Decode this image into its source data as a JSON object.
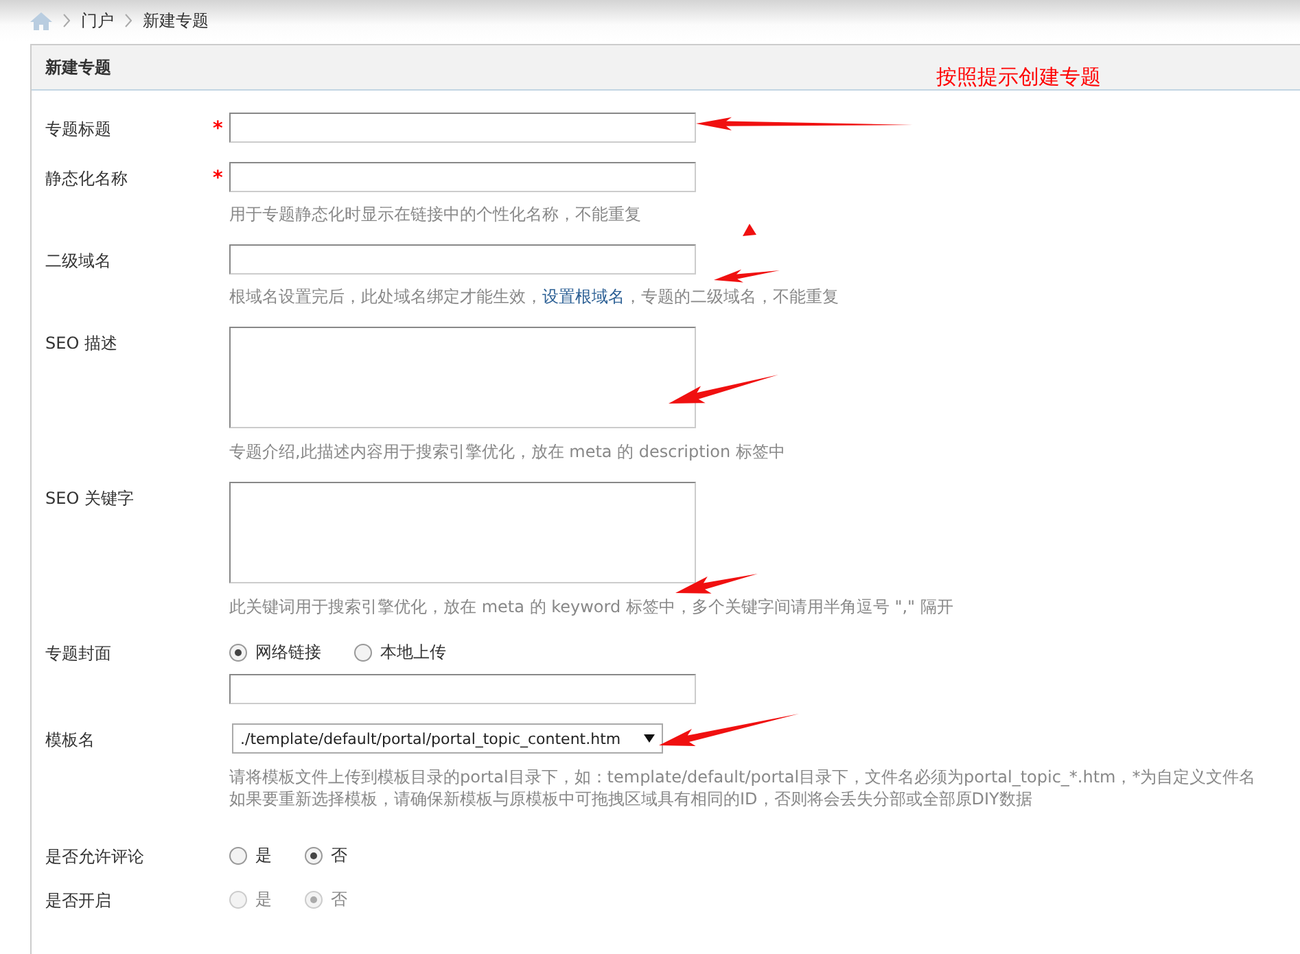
{
  "breadcrumb": [
    "门户",
    "新建专题"
  ],
  "panel": {
    "title": "新建专题",
    "annotation": "按照提示创建专题"
  },
  "fields": [
    {
      "kind": "text",
      "label": "专题标题",
      "required_mark": "*"
    },
    {
      "kind": "text",
      "label": "静态化名称",
      "required_mark": "*",
      "hint": [
        "用于专题静态化时显示在链接中的个性化名称，不能重复"
      ]
    },
    {
      "kind": "text",
      "label": "二级域名",
      "hint_before": "根域名设置完后，此处域名绑定才能生效，",
      "hint_link": "设置根域名",
      "hint_after": "，专题的二级域名，不能重复"
    },
    {
      "kind": "textarea",
      "label": "SEO 描述",
      "hint": [
        "专题介绍,此描述内容用于搜索引擎优化，放在 meta 的 description 标签中"
      ]
    },
    {
      "kind": "textarea",
      "label": "SEO 关键字",
      "hint": [
        "此关键词用于搜索引擎优化，放在 meta 的 keyword 标签中，多个关键字间请用半角逗号 \",\" 隔开"
      ]
    },
    {
      "kind": "radio_input",
      "label": "专题封面",
      "disabled": false,
      "options": [
        {
          "label": "网络链接",
          "selected": true
        },
        {
          "label": "本地上传",
          "selected": false
        }
      ]
    },
    {
      "kind": "select",
      "label": "模板名",
      "value": "./template/default/portal/portal_topic_content.htm",
      "hint": [
        "请将模板文件上传到模板目录的portal目录下，如：template/default/portal目录下，文件名必须为portal_topic_*.htm，*为自定义文件名",
        "如果要重新选择模板，请确保新模板与原模板中可拖拽区域具有相同的ID，否则将会丢失分部或全部原DIY数据"
      ]
    },
    {
      "kind": "radio",
      "label": "是否允许评论",
      "disabled": false,
      "options": [
        {
          "label": "是",
          "selected": false
        },
        {
          "label": "否",
          "selected": true
        }
      ]
    },
    {
      "kind": "radio",
      "label": "是否开启",
      "disabled": true,
      "options": [
        {
          "label": "是",
          "selected": false
        },
        {
          "label": "否",
          "selected": true
        }
      ]
    }
  ]
}
